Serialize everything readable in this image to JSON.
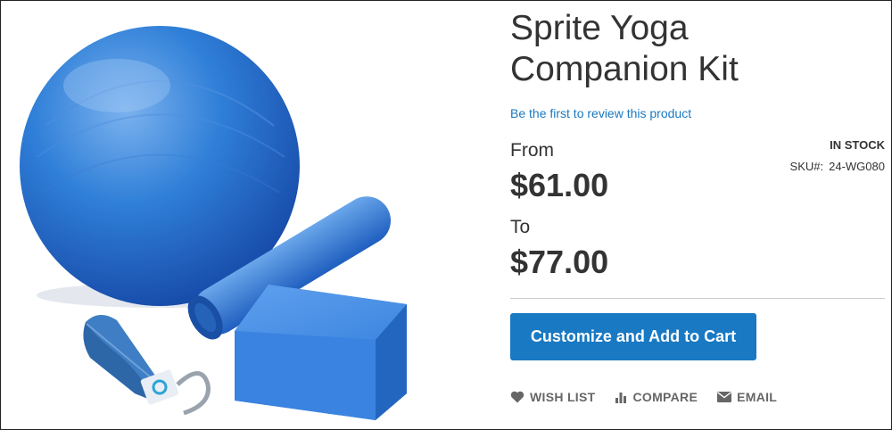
{
  "product": {
    "title": "Sprite Yoga Companion Kit",
    "review_link": "Be the first to review this product",
    "from_label": "From",
    "from_price": "$61.00",
    "to_label": "To",
    "to_price": "$77.00",
    "stock": "IN STOCK",
    "sku_label": "SKU#:",
    "sku_value": "24-WG080"
  },
  "actions": {
    "add_to_cart": "Customize and Add to Cart",
    "wishlist": "WISH LIST",
    "compare": "COMPARE",
    "email": "EMAIL"
  },
  "icons": {
    "wishlist": "heart-icon",
    "compare": "bar-chart-icon",
    "email": "envelope-icon"
  },
  "colors": {
    "accent": "#1979c3",
    "text": "#333333",
    "muted": "#666666"
  }
}
